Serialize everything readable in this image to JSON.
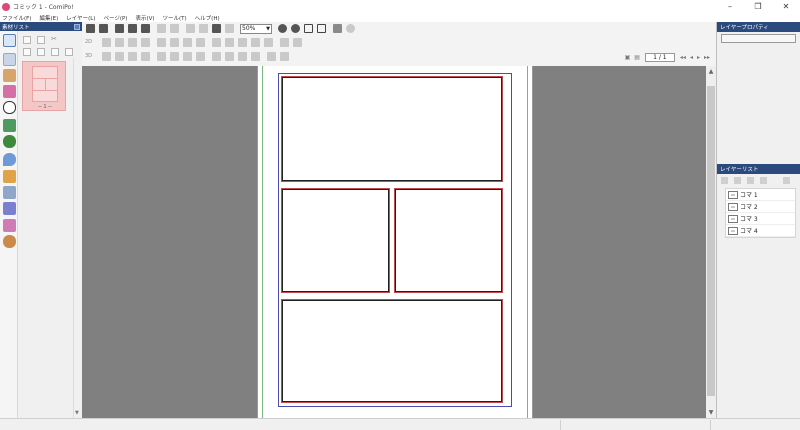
{
  "window": {
    "title": "コミック 1 - ComiPo!",
    "minimize": "–",
    "restore": "❐",
    "close": "✕"
  },
  "menu": [
    "ファイル(F)",
    "編集(E)",
    "レイヤー(L)",
    "ページ(P)",
    "表示(V)",
    "ツール(T)",
    "ヘルプ(H)"
  ],
  "left_panel": {
    "title": "素材リスト",
    "thumbnail_label": "－１－"
  },
  "toolbar": {
    "zoom_value": "50%",
    "page_indicator": "1 / 1",
    "row_labels": [
      "2D",
      "3D"
    ]
  },
  "right_panel": {
    "properties_title": "レイヤープロパティ",
    "layers_title": "レイヤーリスト",
    "layers": [
      {
        "label": "コマ 1",
        "icon": "frame-icon"
      },
      {
        "label": "コマ 2",
        "icon": "frame-icon"
      },
      {
        "label": "コマ 3",
        "icon": "frame-icon"
      },
      {
        "label": "コマ 4",
        "icon": "frame-icon"
      }
    ]
  },
  "colors": {
    "panel_header": "#2b4a7e",
    "canvas_bg": "#808080",
    "thumbnail": "#f4c6c6",
    "app_icon": "#e0457b"
  }
}
